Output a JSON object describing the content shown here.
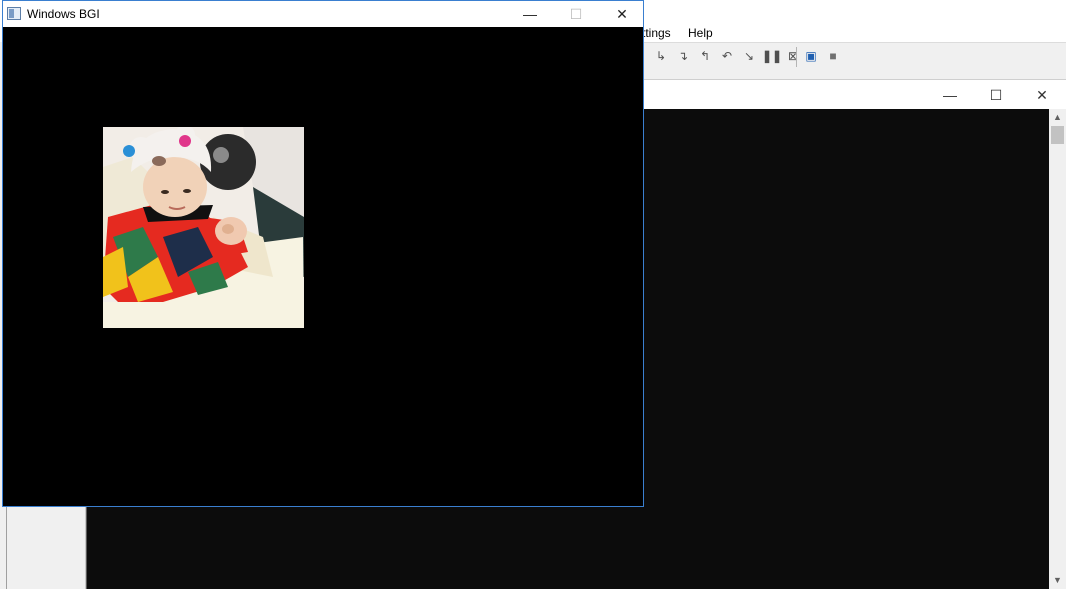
{
  "bgi_window": {
    "title": "Windows BGI",
    "controls": {
      "minimize": "—",
      "maximize": "☐",
      "close": "✕"
    }
  },
  "ide": {
    "menu": [
      {
        "label": "ttings"
      },
      {
        "label": "Help"
      }
    ]
  },
  "console_window": {
    "controls": {
      "minimize": "—",
      "maximize": "☐",
      "close": "✕"
    }
  },
  "colors": {
    "bgi_border": "#3a7fd0",
    "console_bg": "#0c0c0c",
    "canvas_bg": "#000000"
  },
  "icons": [
    "app-icon",
    "minimize-icon",
    "maximize-icon",
    "close-icon",
    "debug-step-icon",
    "pause-icon",
    "stop-icon",
    "run-icon"
  ]
}
